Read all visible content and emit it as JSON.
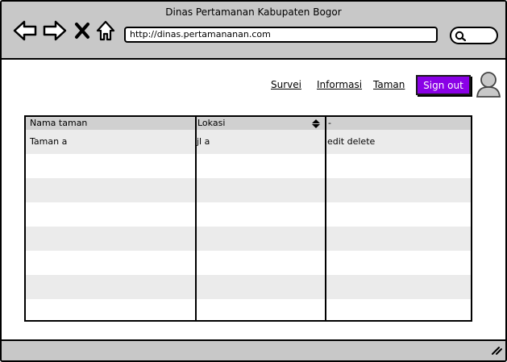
{
  "window": {
    "title": "Dinas Pertamanan Kabupaten Bogor"
  },
  "browser": {
    "url": "http://dinas.pertamananan.com",
    "back_icon": "arrow-left-icon",
    "forward_icon": "arrow-right-icon",
    "close_icon": "x-icon",
    "home_icon": "home-icon",
    "search_icon": "search-icon"
  },
  "nav": {
    "links": [
      "Survei",
      "Informasi",
      "Taman"
    ],
    "signout_label": "Sign out",
    "avatar_icon": "user-avatar-icon"
  },
  "table": {
    "headers": [
      "Nama taman",
      "Lokasi",
      "-"
    ],
    "sort_icon": "sort-icon",
    "rows": [
      [
        "Taman a",
        "jl a",
        "edit delete"
      ]
    ]
  },
  "colors": {
    "accent": "#8a00e6",
    "chrome": "#c8c8c8",
    "header_row": "#d0d0d0",
    "stripe": "#ebebeb"
  }
}
